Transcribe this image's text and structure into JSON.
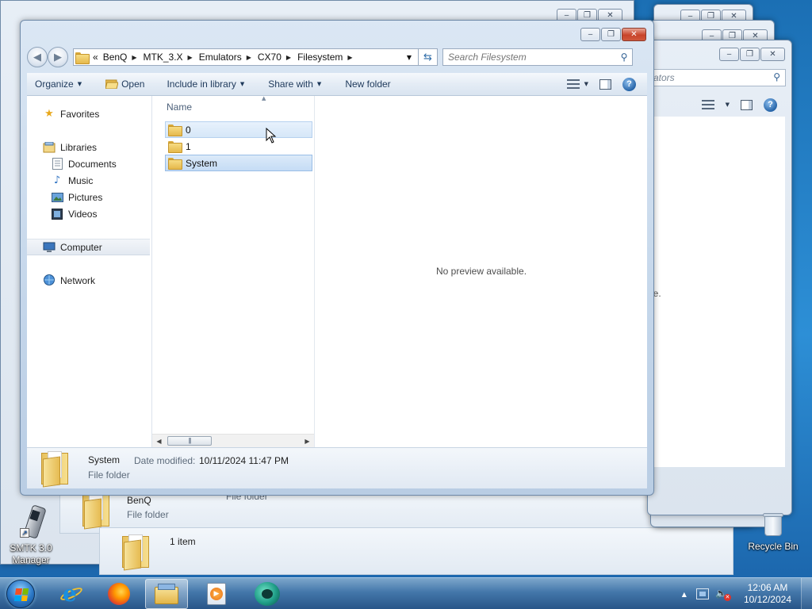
{
  "background_windows": {
    "search_fragment": "ators",
    "preview_fragment": "le.",
    "details_back": {
      "name": "BenQ",
      "type": "File folder",
      "type_mid": "File folder",
      "status": "1 item"
    }
  },
  "window": {
    "address": {
      "overflow": "«",
      "crumbs": [
        "BenQ",
        "MTK_3.X",
        "Emulators",
        "CX70",
        "Filesystem"
      ]
    },
    "search": {
      "placeholder": "Search Filesystem"
    },
    "toolbar": {
      "organize": "Organize",
      "open": "Open",
      "include_in_library": "Include in library",
      "share_with": "Share with",
      "new_folder": "New folder"
    },
    "nav_pane": {
      "favorites": "Favorites",
      "libraries": "Libraries",
      "documents": "Documents",
      "music": "Music",
      "pictures": "Pictures",
      "videos": "Videos",
      "computer": "Computer",
      "network": "Network"
    },
    "file_list": {
      "column_name": "Name",
      "items": [
        {
          "name": "0",
          "state": "hover"
        },
        {
          "name": "1",
          "state": "normal"
        },
        {
          "name": "System",
          "state": "selected"
        }
      ]
    },
    "preview": {
      "message": "No preview available."
    },
    "details": {
      "name": "System",
      "date_modified_label": "Date modified:",
      "date_modified_value": "10/11/2024 11:47 PM",
      "type": "File folder"
    }
  },
  "desktop": {
    "icons": [
      {
        "label_line1": "SMTK 3.0",
        "label_line2": "Manager"
      },
      {
        "label_line1": "Recycle Bin"
      }
    ]
  },
  "taskbar": {
    "clock": {
      "time": "12:06 AM",
      "date": "10/12/2024"
    }
  }
}
